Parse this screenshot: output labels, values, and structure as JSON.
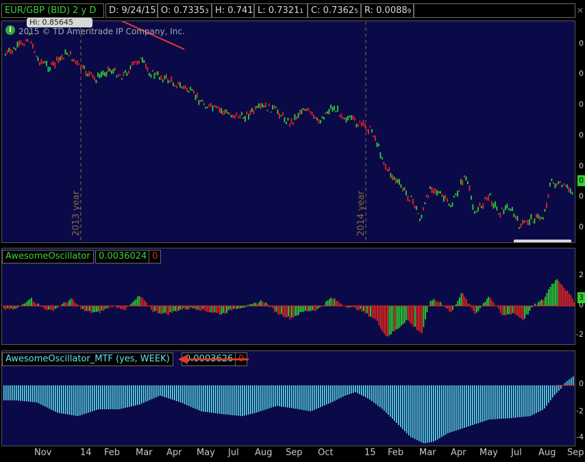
{
  "infobar": {
    "symbol": "EUR/GBP (BID) 2 y D",
    "date": "D: 9/24/15",
    "open_main": "O: 0.7335",
    "open_small": "3",
    "high": "H: 0.741",
    "low_main": "L: 0.7321",
    "low_small": "1",
    "close_main": "C: 0.7362",
    "close_small": "5",
    "range_main": "R: 0.0088",
    "range_small": "9",
    "close_icon": "close-icon"
  },
  "price_panel": {
    "hi_label": "Hi: 0.85645",
    "copyright": "2015 © TD Ameritrade IP Company, Inc.",
    "info_icon": "i",
    "year_labels": [
      "2013 year",
      "2014 year"
    ],
    "right_ticks": [
      "0",
      "0",
      "0",
      "0",
      "0",
      "0",
      "0"
    ],
    "last_tag": "0"
  },
  "ao_panel": {
    "name": "AwesomeOscillator",
    "value": "0.0036024",
    "flag": "0",
    "right_ticks": [
      "2",
      "0",
      "-2"
    ],
    "last_tag": "3"
  },
  "mtf_panel": {
    "name": "AwesomeOscillator_MTF (yes, WEEK)",
    "value": "0.0003626",
    "flag": "0",
    "right_ticks": [
      "0",
      "-2",
      "-4"
    ]
  },
  "x_axis": {
    "labels": [
      "Nov",
      "14",
      "Feb",
      "Mar",
      "Apr",
      "May",
      "Jul",
      "Aug",
      "Sep",
      "Oct",
      "15",
      "Feb",
      "Mar",
      "Apr",
      "May",
      "Jul",
      "Aug",
      "Sep"
    ]
  },
  "colors": {
    "background": "#0b0a48",
    "up": "#2fd12f",
    "down": "#e0261e",
    "mtf": "#5fe6f0",
    "annotation_arrow": "#e03a2f"
  }
}
